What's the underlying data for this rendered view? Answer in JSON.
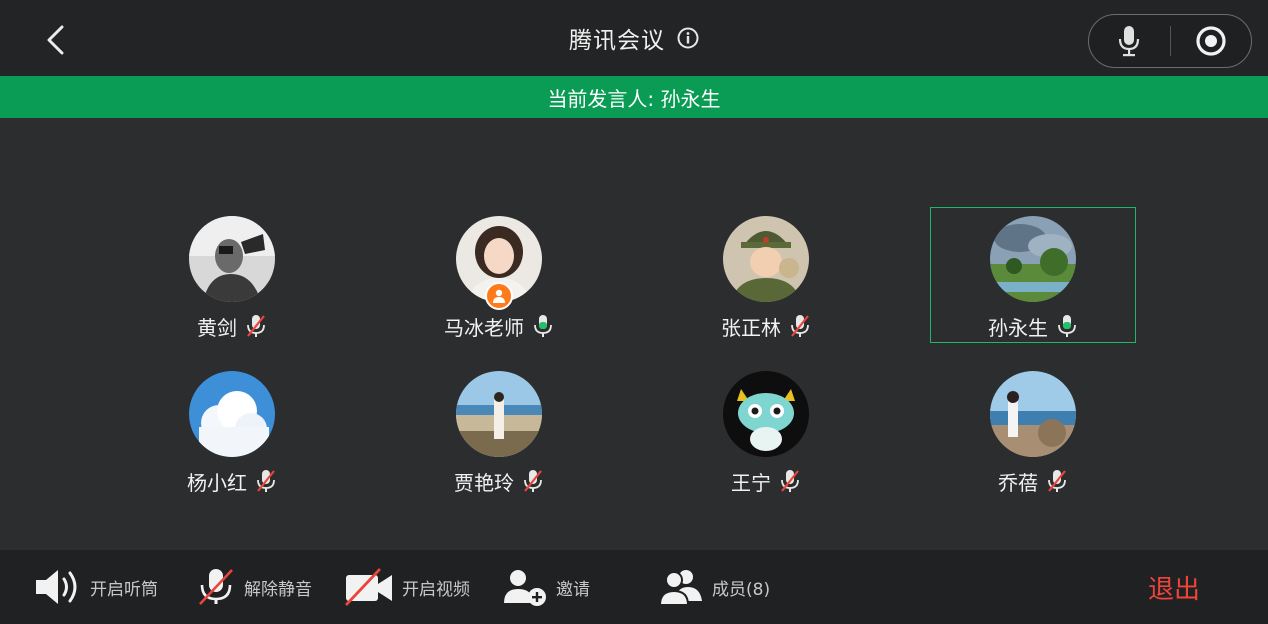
{
  "header": {
    "title": "腾讯会议",
    "back_icon": "chevron-left-icon",
    "info_icon": "info-icon",
    "mic_icon": "microphone-icon",
    "record_icon": "record-icon"
  },
  "speaker_bar": {
    "text": "当前发言人: 孙永生",
    "color": "#0a9b54"
  },
  "participants": [
    {
      "name": "黄剑",
      "mic": "muted",
      "host": false,
      "active": false
    },
    {
      "name": "马冰老师",
      "mic": "on",
      "host": true,
      "active": false
    },
    {
      "name": "张正林",
      "mic": "muted",
      "host": false,
      "active": false
    },
    {
      "name": "孙永生",
      "mic": "on",
      "host": false,
      "active": true
    },
    {
      "name": "杨小红",
      "mic": "muted",
      "host": false,
      "active": false
    },
    {
      "name": "贾艳玲",
      "mic": "muted",
      "host": false,
      "active": false
    },
    {
      "name": "王宁",
      "mic": "muted",
      "host": false,
      "active": false
    },
    {
      "name": "乔蓓",
      "mic": "muted",
      "host": false,
      "active": false
    }
  ],
  "toolbar": {
    "speaker": {
      "label": "开启听筒",
      "icon": "speaker-icon"
    },
    "unmute": {
      "label": "解除静音",
      "icon": "mic-muted-icon"
    },
    "video": {
      "label": "开启视频",
      "icon": "video-off-icon"
    },
    "invite": {
      "label": "邀请",
      "icon": "add-user-icon"
    },
    "members": {
      "label": "成员(8)",
      "icon": "members-icon"
    },
    "exit": {
      "label": "退出",
      "color": "#f0443a"
    }
  },
  "colors": {
    "mic_on": "#22c26a",
    "mic_muted_slash": "#e8463c",
    "active_border": "#1fb866"
  }
}
